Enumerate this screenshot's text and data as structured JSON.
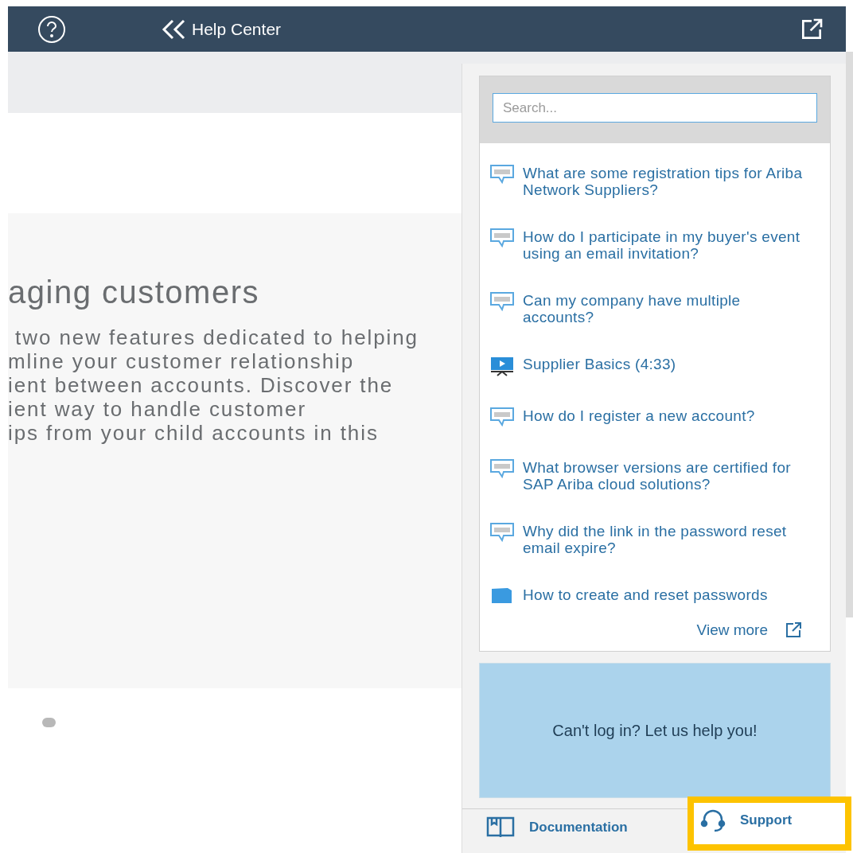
{
  "header": {
    "title": "Help Center"
  },
  "content": {
    "heading": "aging customers",
    "lines": [
      " two new features dedicated to helping",
      "mline your customer relationship",
      "ient between accounts. Discover the",
      "ient way to handle customer",
      "ips from your child accounts in this"
    ]
  },
  "help_panel": {
    "search": {
      "placeholder": "Search..."
    },
    "items": [
      {
        "kind": "faq",
        "label": "What are some registration tips for Ariba Network Suppliers?"
      },
      {
        "kind": "faq",
        "label": "How do I participate in my buyer's event using an email invitation?"
      },
      {
        "kind": "faq",
        "label": "Can my company have multiple accounts?"
      },
      {
        "kind": "video",
        "label": "Supplier Basics (4:33)"
      },
      {
        "kind": "faq",
        "label": "How do I register a new account?"
      },
      {
        "kind": "faq",
        "label": "What browser versions are certified for SAP Ariba cloud solutions?"
      },
      {
        "kind": "faq",
        "label": "Why did the link in the password reset email expire?"
      },
      {
        "kind": "document",
        "label": "How to create and reset passwords"
      }
    ],
    "view_more": "View more",
    "banner": "Can't log in? Let us help you!",
    "footer": [
      {
        "kind": "documentation",
        "label": "Documentation",
        "highlighted": false
      },
      {
        "kind": "support",
        "label": "Support",
        "highlighted": true
      }
    ]
  }
}
